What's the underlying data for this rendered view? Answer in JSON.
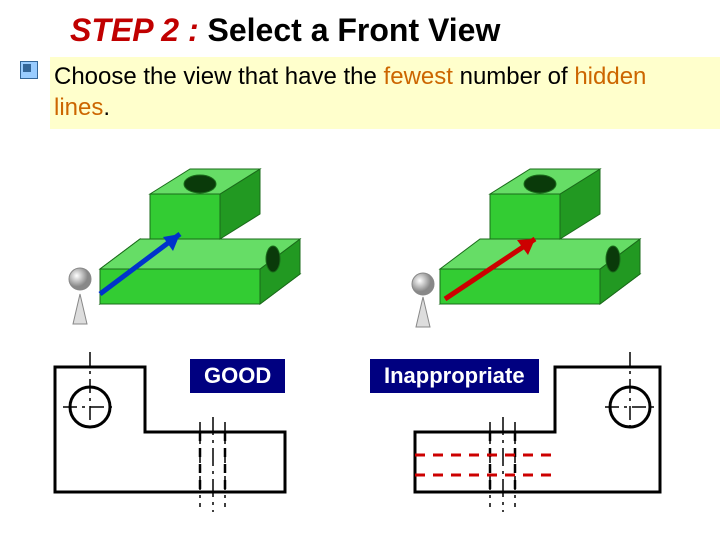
{
  "title": {
    "step": "STEP 2 :",
    "rest": " Select  a  Front  View"
  },
  "subtitle": {
    "pre": "Choose the view that have the ",
    "hl1": "fewest",
    "mid": " number of ",
    "hl2": "hidden lines",
    "post": "."
  },
  "labels": {
    "good": "GOOD",
    "bad": "Inappropriate"
  },
  "colors": {
    "good_arrow": "#0033cc",
    "bad_arrow": "#cc0000",
    "block_face": "#33cc33",
    "block_top": "#66dd66",
    "block_side": "#229922",
    "hidden": "#cc0000"
  }
}
